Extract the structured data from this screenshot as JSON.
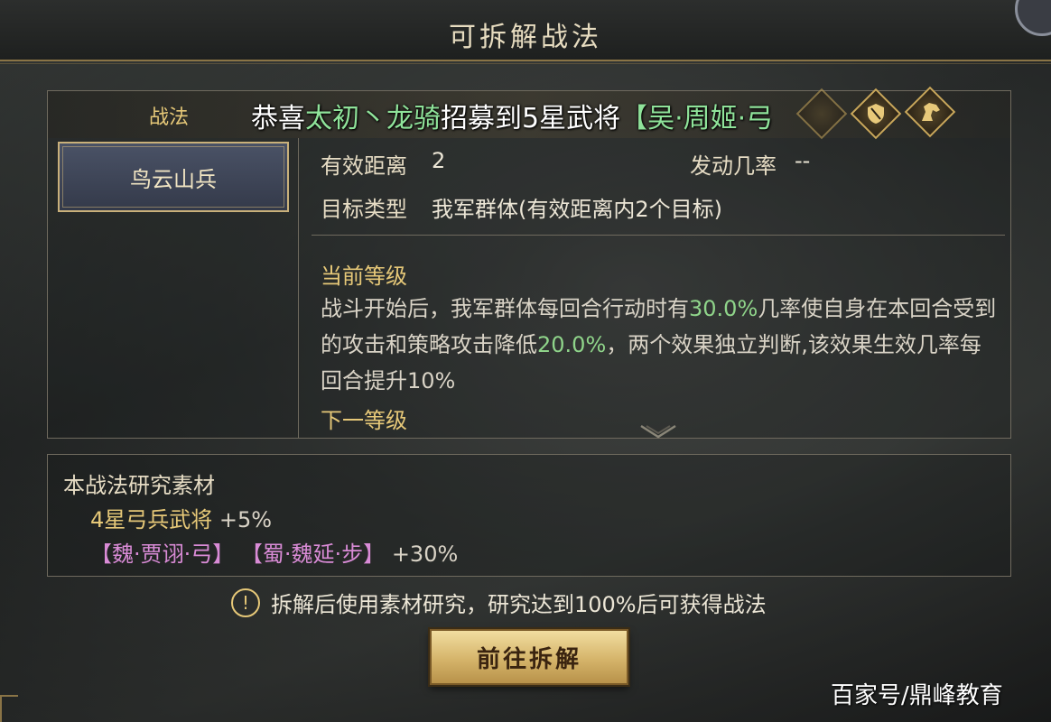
{
  "header": {
    "title": "可拆解战法"
  },
  "tab": {
    "label": "战法"
  },
  "announcement": {
    "prefix": "恭喜",
    "name_green": "太初丶龙骑",
    "middle": "招募到5星武将",
    "general_green": "【吴·周姬·弓"
  },
  "skill_list": {
    "items": [
      {
        "label": "鸟云山兵"
      }
    ]
  },
  "details": {
    "range_label": "有效距离",
    "range_value": "2",
    "rate_label": "发动几率",
    "rate_value": "--",
    "target_label": "目标类型",
    "target_value": "我军群体(有效距离内2个目标)"
  },
  "current_level": {
    "heading": "当前等级",
    "desc_1": "战斗开始后，我军群体每回合行动时有",
    "desc_pct1": "30.0%",
    "desc_2": "几率使自身在本回合受到的攻击和策略攻击降低",
    "desc_pct2": "20.0%",
    "desc_3": "，两个效果独立判断,该效果生效几率每回合提升10%"
  },
  "next_level": {
    "heading": "下一等级"
  },
  "materials": {
    "title": "本战法研究素材",
    "line1_text": "4星弓兵武将",
    "line1_bonus": "+5%",
    "line2_item1": "【魏·贾诩·弓】",
    "line2_item2": "【蜀·魏延·步】",
    "line2_bonus": "+30%"
  },
  "hint": {
    "icon": "!",
    "text": "拆解后使用素材研究，研究达到100%后可获得战法"
  },
  "actions": {
    "go_label": "前往拆解"
  },
  "watermark": {
    "text": "百家号/鼎峰教育"
  },
  "icons": [
    "shield-diamond-icon",
    "horse-diamond-icon",
    "ornament-diamond-icon"
  ],
  "colors": {
    "gold": "#e6c878",
    "green": "#8fd48a",
    "purple": "#d98bd6",
    "button": "#d5b46a"
  }
}
